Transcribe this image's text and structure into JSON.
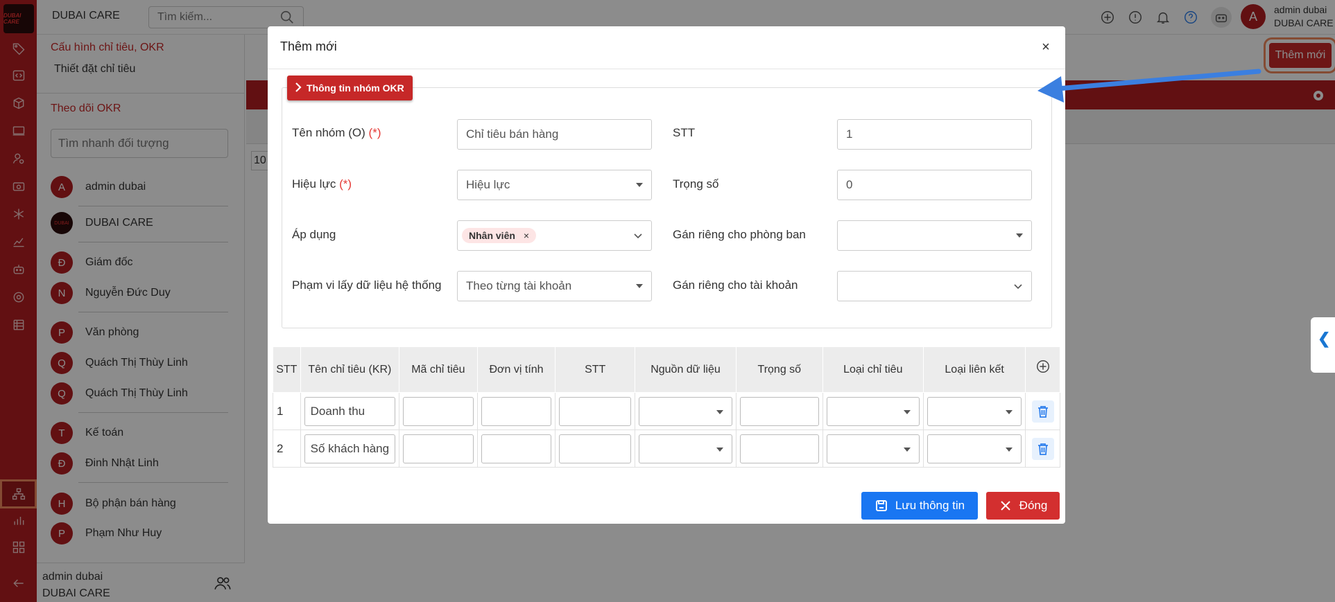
{
  "topbar": {
    "brand": "DUBAI CARE",
    "search_placeholder": "Tìm kiếm...",
    "avatar_letter": "A",
    "user_name": "admin dubai",
    "user_org": "DUBAI CARE"
  },
  "rail": {
    "logo_text": "DUBAI CARE"
  },
  "panel": {
    "config_title": "Cấu hình chỉ tiêu, OKR",
    "config_sub": "Thiết đặt chỉ tiêu",
    "track_title": "Theo dõi OKR",
    "quick_placeholder": "Tìm nhanh đối tượng",
    "items": [
      {
        "avatar": "A",
        "name": "admin dubai"
      },
      {
        "avatar": "",
        "name": "DUBAI CARE"
      },
      {
        "avatar": "Đ",
        "name": "Giám đốc"
      },
      {
        "avatar": "N",
        "name": "Nguyễn Đức Duy"
      },
      {
        "avatar": "P",
        "name": "Văn phòng"
      },
      {
        "avatar": "Q",
        "name": "Quách Thị Thùy Linh"
      },
      {
        "avatar": "Q",
        "name": "Quách Thị Thùy Linh"
      },
      {
        "avatar": "T",
        "name": "Kế toán"
      },
      {
        "avatar": "Đ",
        "name": "Đinh Nhật Linh"
      },
      {
        "avatar": "H",
        "name": "Bộ phận bán hàng"
      },
      {
        "avatar": "P",
        "name": "Phạm Như Huy"
      }
    ],
    "footer_name": "admin dubai",
    "footer_org": "DUBAI CARE"
  },
  "main": {
    "add_button": "Thêm mới",
    "page_size": "10"
  },
  "modal": {
    "title": "Thêm mới",
    "close_symbol": "×",
    "section_title": "Thông tin nhóm OKR",
    "required_mark": "(*)",
    "fields": {
      "group_name_label": "Tên nhóm (O)",
      "group_name_value": "Chỉ tiêu bán hàng",
      "stt_label": "STT",
      "stt_value": "1",
      "validity_label": "Hiệu lực",
      "validity_value": "Hiệu lực",
      "weight_label": "Trọng số",
      "weight_value": "0",
      "apply_label": "Áp dụng",
      "apply_tag": "Nhân viên",
      "apply_tag_remove": "×",
      "dept_label": "Gán riêng cho phòng ban",
      "dept_value": "",
      "scope_label": "Phạm vi lấy dữ liệu hệ thống",
      "scope_value": "Theo từng tài khoản",
      "account_label": "Gán riêng cho tài khoản",
      "account_value": ""
    },
    "table": {
      "headers": [
        "STT",
        "Tên chỉ tiêu (KR)",
        "Mã chỉ tiêu",
        "Đơn vị tính",
        "STT",
        "Nguồn dữ liệu",
        "Trọng số",
        "Loại chỉ tiêu",
        "Loại liên kết"
      ],
      "rows": [
        {
          "stt": "1",
          "name": "Doanh thu"
        },
        {
          "stt": "2",
          "name": "Số khách hàng"
        }
      ]
    },
    "save_button": "Lưu thông tin",
    "close_button": "Đóng"
  },
  "colors": {
    "brand_red": "#b21e22",
    "primary_blue": "#1976f2",
    "danger_red": "#d32f2f",
    "highlight_orange": "#f0895e",
    "arrow_blue": "#3b7fe0"
  }
}
